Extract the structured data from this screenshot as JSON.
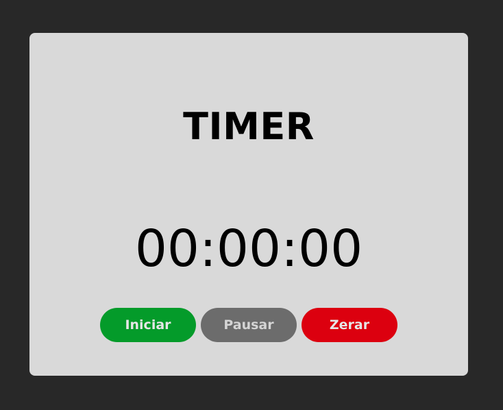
{
  "timer": {
    "title": "TIMER",
    "display": "00:00:00"
  },
  "buttons": {
    "start_label": "Iniciar",
    "pause_label": "Pausar",
    "reset_label": "Zerar"
  },
  "colors": {
    "page_background": "#282828",
    "card_background": "#d9d9d9",
    "start_button": "#049b2a",
    "pause_button": "#6c6c6c",
    "reset_button": "#dc000f",
    "text": "#000000"
  }
}
